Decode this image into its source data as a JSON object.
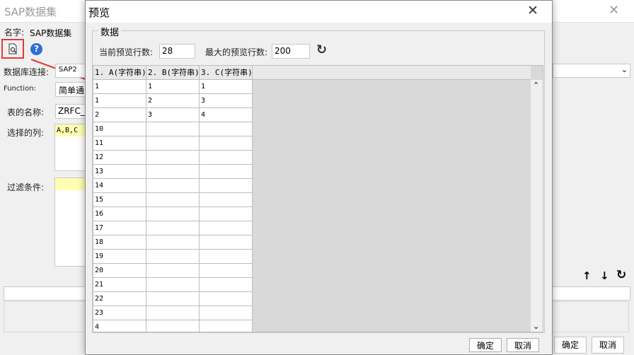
{
  "bg": {
    "title": "SAP数据集",
    "name_label": "名字:",
    "name_value": "SAP数据集",
    "db_label": "数据库连接:",
    "db_value": "SAP2",
    "function_label": "Function:",
    "function_value": "简单通",
    "table_label": "表的名称:",
    "table_value": "ZRFC_",
    "columns_label": "选择的列:",
    "columns_value": "A,B,C",
    "filter_label": "过滤条件:",
    "ok": "确定",
    "cancel": "取消"
  },
  "dialog": {
    "title": "预览",
    "group_label": "数据",
    "current_rows_label": "当前预览行数:",
    "current_rows_value": "28",
    "max_rows_label": "最大的预览行数:",
    "max_rows_value": "200",
    "columns": [
      "1. A(字符串)",
      "2. B(字符串)",
      "3. C(字符串)"
    ],
    "rows": [
      [
        "1",
        "1",
        "1"
      ],
      [
        "1",
        "2",
        "3"
      ],
      [
        "2",
        "3",
        "4"
      ],
      [
        "10",
        "",
        ""
      ],
      [
        "11",
        "",
        ""
      ],
      [
        "12",
        "",
        ""
      ],
      [
        "13",
        "",
        ""
      ],
      [
        "14",
        "",
        ""
      ],
      [
        "15",
        "",
        ""
      ],
      [
        "16",
        "",
        ""
      ],
      [
        "17",
        "",
        ""
      ],
      [
        "18",
        "",
        ""
      ],
      [
        "19",
        "",
        ""
      ],
      [
        "20",
        "",
        ""
      ],
      [
        "21",
        "",
        ""
      ],
      [
        "22",
        "",
        ""
      ],
      [
        "23",
        "",
        ""
      ],
      [
        "4",
        "",
        ""
      ]
    ],
    "ok": "确定",
    "cancel": "取消"
  },
  "colors": {
    "highlight_red": "#e53935",
    "help_blue": "#2b6fd6",
    "field_yellow": "#ffffb3"
  }
}
